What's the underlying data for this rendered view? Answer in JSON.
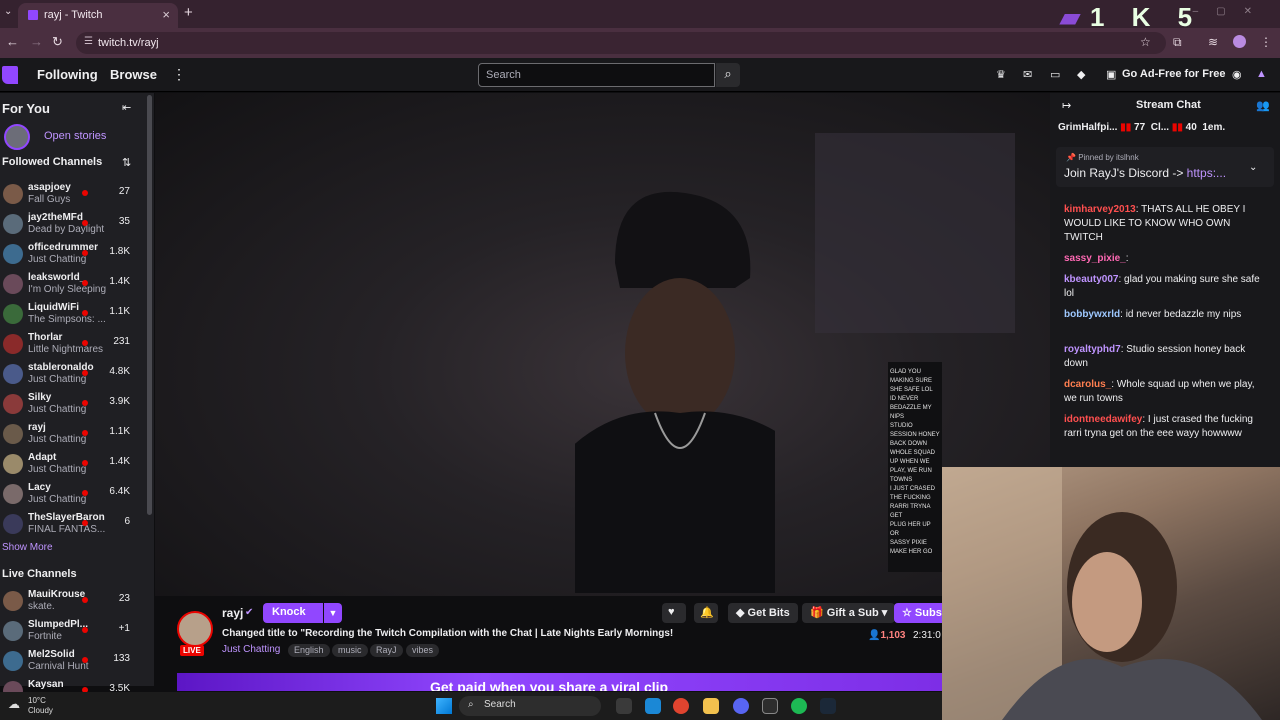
{
  "browser": {
    "tab_title": "rayj - Twitch",
    "url": "twitch.tv/rayj",
    "overlay_text": "1 K 5"
  },
  "topnav": {
    "following": "Following",
    "browse": "Browse",
    "search_placeholder": "Search",
    "ad_free": "Go Ad-Free for Free"
  },
  "sidebar": {
    "for_you": "For You",
    "open_stories": "Open stories",
    "followed_header": "Followed Channels",
    "channels": [
      {
        "name": "asapjoey",
        "game": "Fall Guys",
        "viewers": "27"
      },
      {
        "name": "jay2theMFd",
        "game": "Dead by Daylight",
        "viewers": "35"
      },
      {
        "name": "officedrummer",
        "game": "Just Chatting",
        "viewers": "1.8K"
      },
      {
        "name": "leaksworld_",
        "game": "I'm Only Sleeping",
        "viewers": "1.4K"
      },
      {
        "name": "LiquidWiFi",
        "game": "The Simpsons: ...",
        "viewers": "1.1K"
      },
      {
        "name": "Thorlar",
        "game": "Little Nightmares",
        "viewers": "231"
      },
      {
        "name": "stableronaldo",
        "game": "Just Chatting",
        "viewers": "4.8K"
      },
      {
        "name": "Silky",
        "game": "Just Chatting",
        "viewers": "3.9K"
      },
      {
        "name": "rayj",
        "game": "Just Chatting",
        "viewers": "1.1K"
      },
      {
        "name": "Adapt",
        "game": "Just Chatting",
        "viewers": "1.4K"
      },
      {
        "name": "Lacy",
        "game": "Just Chatting",
        "viewers": "6.4K"
      },
      {
        "name": "TheSlayerBaron",
        "game": "FINAL FANTAS...",
        "viewers": "6"
      }
    ],
    "show_more": "Show More",
    "live_header": "Live Channels",
    "live_channels": [
      {
        "name": "MauiKrouse",
        "game": "skate.",
        "viewers": "23"
      },
      {
        "name": "SlumpedPl...",
        "game": "Fortnite",
        "viewers": "+1"
      },
      {
        "name": "Mel2Solid",
        "game": "Carnival Hunt",
        "viewers": "133"
      },
      {
        "name": "Kaysan",
        "game": "",
        "viewers": "3.5K"
      }
    ]
  },
  "stream": {
    "channel": "rayj",
    "knock": "Knock",
    "title": "Changed title to \"Recording the Twitch Compilation with the Chat | Late Nights Early Mornings!",
    "category": "Just Chatting",
    "tags": [
      "English",
      "music",
      "RayJ",
      "vibes"
    ],
    "live": "LIVE",
    "viewers": "1,103",
    "uptime": "2:31:0",
    "get_bits": "Get Bits",
    "gift_sub": "Gift a Sub",
    "subscribe": "Subs",
    "promo": "Get paid when you share a viral clip"
  },
  "chat": {
    "header": "Stream Chat",
    "hype": [
      {
        "name": "GrimHalfpi...",
        "count": "77"
      },
      {
        "name": "Cl...",
        "count": "40"
      },
      {
        "name": "1em.",
        "count": ""
      }
    ],
    "pinned_by": "Pinned by",
    "pinned_user": "itslhnk",
    "pinned_msg": "Join RayJ's Discord ->",
    "pinned_link": "https:...",
    "messages": [
      {
        "user": "kimharvey2013",
        "color": "#ff4f4f",
        "text": "THATS ALL HE OBEY I WOULD LIKE TO KNOW WHO OWN TWITCH"
      },
      {
        "user": "sassy_pixie_",
        "color": "#ff69b4",
        "text": ""
      },
      {
        "user": "kbeauty007",
        "color": "#bf94ff",
        "text": "glad you making sure she safe lol"
      },
      {
        "user": "bobbywxrld",
        "color": "#9ec8ff",
        "text": "id never bedazzle my nips"
      },
      {
        "user": "royaltyphd7",
        "color": "#bf94ff",
        "text": "Studio session honey back down"
      },
      {
        "user": "dcarolus_",
        "color": "#ff7f50",
        "text": "Whole squad up when we play, we run towns"
      },
      {
        "user": "idontneedawifey",
        "color": "#ff4f4f",
        "text": "I just crased the fucking rarri tryna get on the eee wayy howwww"
      }
    ]
  },
  "taskbar": {
    "temp": "10°C",
    "condition": "Cloudy",
    "search": "Search"
  },
  "colors": {
    "accent": "#9147ff",
    "live": "#eb0400",
    "bg": "#0e0e10",
    "browser": "#35222f"
  }
}
